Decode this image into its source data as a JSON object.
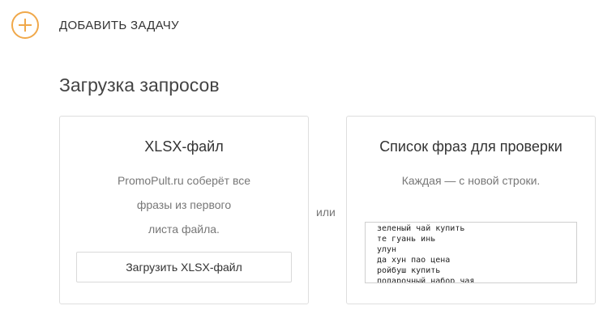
{
  "add_task": {
    "label": "ДОБАВИТЬ ЗАДАЧУ",
    "icon": "plus-circle-icon",
    "accent_color": "#f0a84a"
  },
  "section": {
    "title": "Загрузка запросов"
  },
  "xlsx_card": {
    "title": "XLSX-файл",
    "description_lines": [
      "PromoPult.ru соберёт все",
      "фразы из первого",
      "листа файла."
    ],
    "upload_button": "Загрузить XLSX-файл"
  },
  "separator": {
    "label": "или"
  },
  "list_card": {
    "title": "Список фраз для проверки",
    "description": "Каждая — с новой строки.",
    "phrases_value": "зеленый чай купить\nте гуань инь\nулун\nда хун пао цена\nройбуш купить\nподарочный набор чая"
  }
}
